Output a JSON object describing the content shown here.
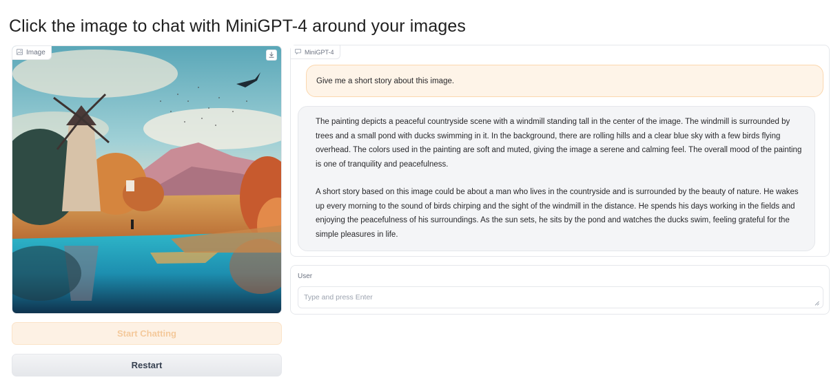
{
  "page": {
    "title": "Click the image to chat with MiniGPT-4 around your images"
  },
  "image_panel": {
    "label": "Image",
    "icon": "image-icon",
    "download_icon": "download-icon"
  },
  "buttons": {
    "start_label": "Start Chatting",
    "restart_label": "Restart"
  },
  "chatbot": {
    "label": "MiniGPT-4",
    "icon": "chat-icon",
    "messages": [
      {
        "role": "user",
        "text": "Give me a short story about this image."
      },
      {
        "role": "bot",
        "paragraphs": [
          "The painting depicts a peaceful countryside scene with a windmill standing tall in the center of the image. The windmill is surrounded by trees and a small pond with ducks swimming in it. In the background, there are rolling hills and a clear blue sky with a few birds flying overhead. The colors used in the painting are soft and muted, giving the image a serene and calming feel. The overall mood of the painting is one of tranquility and peacefulness.",
          "A short story based on this image could be about a man who lives in the countryside and is surrounded by the beauty of nature. He wakes up every morning to the sound of birds chirping and the sight of the windmill in the distance. He spends his days working in the fields and enjoying the peacefulness of his surroundings. As the sun sets, he sits by the pond and watches the ducks swim, feeling grateful for the simple pleasures in life."
        ]
      }
    ]
  },
  "user_input": {
    "label": "User",
    "placeholder": "Type and press Enter",
    "value": ""
  },
  "colors": {
    "accent_orange_bg": "#fdf1e4",
    "accent_orange_border": "#fbd7ae",
    "bot_bubble_bg": "#f4f5f7"
  }
}
